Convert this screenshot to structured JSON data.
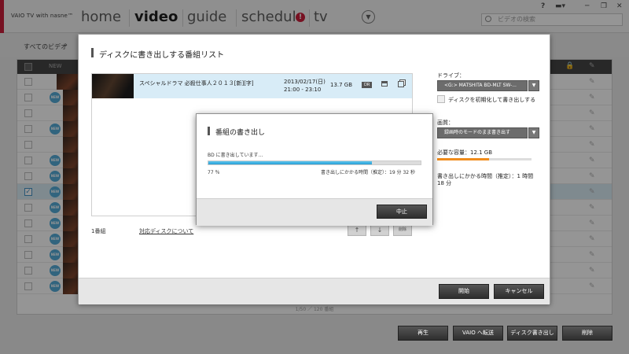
{
  "app": {
    "brand": "VAIO TV with nasne™"
  },
  "nav": {
    "home": "home",
    "video": "video",
    "guide": "guide",
    "schedule": "schedule",
    "schedule_badge": "!",
    "tv": "tv",
    "search_placeholder": "ビデオの検索",
    "help": "?"
  },
  "breadcrumb": {
    "all_videos": "すべてのビデオ",
    "arrow": "›"
  },
  "list": {
    "new_header": "NEW",
    "new_badge": "NEW",
    "footer": "1/50 ／ 120 番組"
  },
  "dialog": {
    "title": "ディスクに書き出しする番組リスト",
    "program": {
      "title": "スペシャルドラマ 必殺仕事人２０１３[新][字]",
      "date": "2013/02/17(日)",
      "time": "21:00 - 23:10",
      "size": "13.7 GB",
      "mode": "DR"
    },
    "count": "1番組",
    "compat_link": "対応ディスクについて",
    "up": "↑",
    "down": "↓",
    "delete": "削除",
    "drive_label": "ドライブ：",
    "drive_value": "<G:> MATSHITA BD-MLT SW-...",
    "init_label": "ディスクを初期化して書き出しする",
    "quality_label": "画質：",
    "quality_value": "録画時のモードのまま書き出す",
    "capacity_label": "必要な容量：12.1 GB",
    "capacity_fraction": 0.55,
    "time_label": "書き出しにかかる時間（推定）：1 時間 18 分",
    "start": "開始",
    "cancel": "キャンセル"
  },
  "burn": {
    "title": "番組の書き出し",
    "status": "BD に書き出しています…",
    "percent_label": "77 ％",
    "percent_value": 77,
    "remaining": "書き出しにかかる時間（推定）：19 分 32 秒",
    "stop": "中止"
  },
  "bottom": {
    "play": "再生",
    "vaio_transfer": "VAIO へ転送",
    "disc_export": "ディスク書き出し",
    "delete": "削除"
  },
  "colors": {
    "brand_red": "#c8102e",
    "progress_blue": "#2a9ed3",
    "capacity_orange": "#f08c1c",
    "selected_row": "#d8ecf7"
  }
}
